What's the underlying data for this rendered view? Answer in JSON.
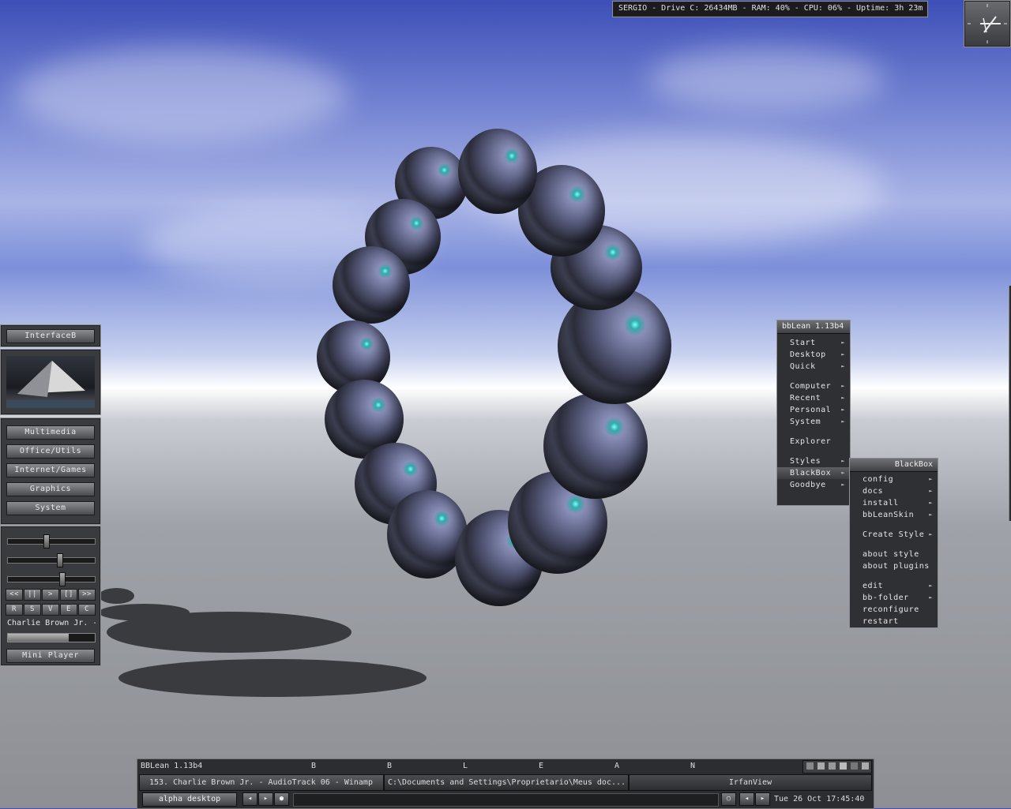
{
  "status_bar": "SERGIO - Drive C: 26434MB - RAM: 40% - CPU: 06% - Uptime: 3h 23m",
  "left_panel": {
    "title": "InterfaceB",
    "categories": [
      "Multimedia",
      "Office/Utils",
      "Internet/Games",
      "Graphics",
      "System"
    ],
    "player": {
      "controls": [
        "<<",
        "||",
        ">",
        "[]",
        ">>"
      ],
      "toggles": [
        "R",
        "S",
        "V",
        "E",
        "C"
      ],
      "track": "Charlie Brown Jr. -",
      "mini_button": "Mini Player",
      "sliders": [
        0.45,
        0.62,
        0.65
      ],
      "progress": 0.7
    }
  },
  "main_menu": {
    "title": "bbLean 1.13b4",
    "items": [
      {
        "label": "Start",
        "submenu": true
      },
      {
        "label": "Desktop",
        "submenu": true
      },
      {
        "label": "Quick",
        "submenu": true
      },
      {
        "label": "",
        "gap": true
      },
      {
        "label": "Computer",
        "submenu": true
      },
      {
        "label": "Recent",
        "submenu": true
      },
      {
        "label": "Personal",
        "submenu": true
      },
      {
        "label": "System",
        "submenu": true
      },
      {
        "label": "",
        "gap": true
      },
      {
        "label": "Explorer",
        "submenu": false
      },
      {
        "label": "",
        "gap": true
      },
      {
        "label": "Styles",
        "submenu": true
      },
      {
        "label": "BlackBox",
        "submenu": true,
        "active": true
      },
      {
        "label": "Goodbye",
        "submenu": true
      }
    ]
  },
  "sub_menu": {
    "title": "BlackBox",
    "items": [
      {
        "label": "config",
        "submenu": true
      },
      {
        "label": "docs",
        "submenu": true
      },
      {
        "label": "install",
        "submenu": true
      },
      {
        "label": "bbLeanSkin",
        "submenu": true
      },
      {
        "label": "",
        "gap": true
      },
      {
        "label": "Create Style",
        "submenu": true
      },
      {
        "label": "",
        "gap": true
      },
      {
        "label": "about style",
        "submenu": false
      },
      {
        "label": "about plugins",
        "submenu": false
      },
      {
        "label": "",
        "gap": true
      },
      {
        "label": "edit",
        "submenu": true
      },
      {
        "label": "bb-folder",
        "submenu": true
      },
      {
        "label": "reconfigure",
        "submenu": false
      },
      {
        "label": "restart",
        "submenu": false
      }
    ]
  },
  "taskbar": {
    "label": "BBLean 1.13b4",
    "workspace_letters": [
      "B",
      "B",
      "L",
      "E",
      "A",
      "N"
    ],
    "tasks": [
      "153. Charlie Brown Jr. - AudioTrack 06 - Winamp",
      "C:\\Documents and Settings\\Proprietario\\Meus doc...",
      "IrfanView"
    ],
    "workspace": "alpha desktop",
    "nav_buttons": [
      "◂",
      "▸",
      "●"
    ],
    "right_buttons": [
      "○",
      "◂",
      "▸"
    ],
    "clock": "Tue 26 Oct 17:45:40"
  }
}
